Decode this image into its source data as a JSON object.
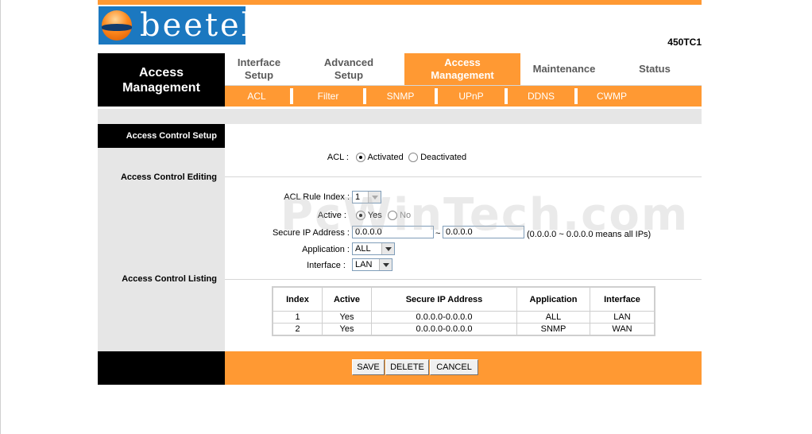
{
  "brand": {
    "logo_text": "beetel",
    "model": "450TC1"
  },
  "section": {
    "title_line1": "Access",
    "title_line2": "Management"
  },
  "main_tabs": [
    {
      "line1": "Interface",
      "line2": "Setup"
    },
    {
      "line1": "Advanced",
      "line2": "Setup"
    },
    {
      "line1": "Access",
      "line2": "Management"
    },
    {
      "line1": "Maintenance",
      "line2": ""
    },
    {
      "line1": "Status",
      "line2": ""
    }
  ],
  "sub_tabs": [
    "ACL",
    "Filter",
    "SNMP",
    "UPnP",
    "DDNS",
    "CWMP"
  ],
  "left": {
    "header": "Access Control Setup",
    "editing": "Access Control Editing",
    "listing": "Access Control Listing"
  },
  "acl": {
    "label": "ACL :",
    "activated": "Activated",
    "deactivated": "Deactivated",
    "selected": "Activated"
  },
  "form": {
    "rule_index_label": "ACL Rule Index :",
    "rule_index_value": "1",
    "active_label": "Active :",
    "active_yes": "Yes",
    "active_no": "No",
    "secure_ip_label": "Secure IP Address :",
    "ip_from": "0.0.0.0",
    "ip_sep": "~",
    "ip_to": "0.0.0.0",
    "ip_hint": "(0.0.0.0 ~ 0.0.0.0 means all IPs)",
    "application_label": "Application :",
    "application_value": "ALL",
    "interface_label": "Interface :",
    "interface_value": "LAN"
  },
  "table": {
    "headers": [
      "Index",
      "Active",
      "Secure IP Address",
      "Application",
      "Interface"
    ],
    "rows": [
      [
        "1",
        "Yes",
        "0.0.0.0-0.0.0.0",
        "ALL",
        "LAN"
      ],
      [
        "2",
        "Yes",
        "0.0.0.0-0.0.0.0",
        "SNMP",
        "WAN"
      ]
    ]
  },
  "buttons": {
    "save": "SAVE",
    "delete": "DELETE",
    "cancel": "CANCEL"
  },
  "watermark": "PcWinTech.com",
  "colors": {
    "accent": "#ff9933",
    "header_black": "#000000",
    "panel_gray": "#e6e6e6",
    "logo_blue": "#1b78c0"
  }
}
